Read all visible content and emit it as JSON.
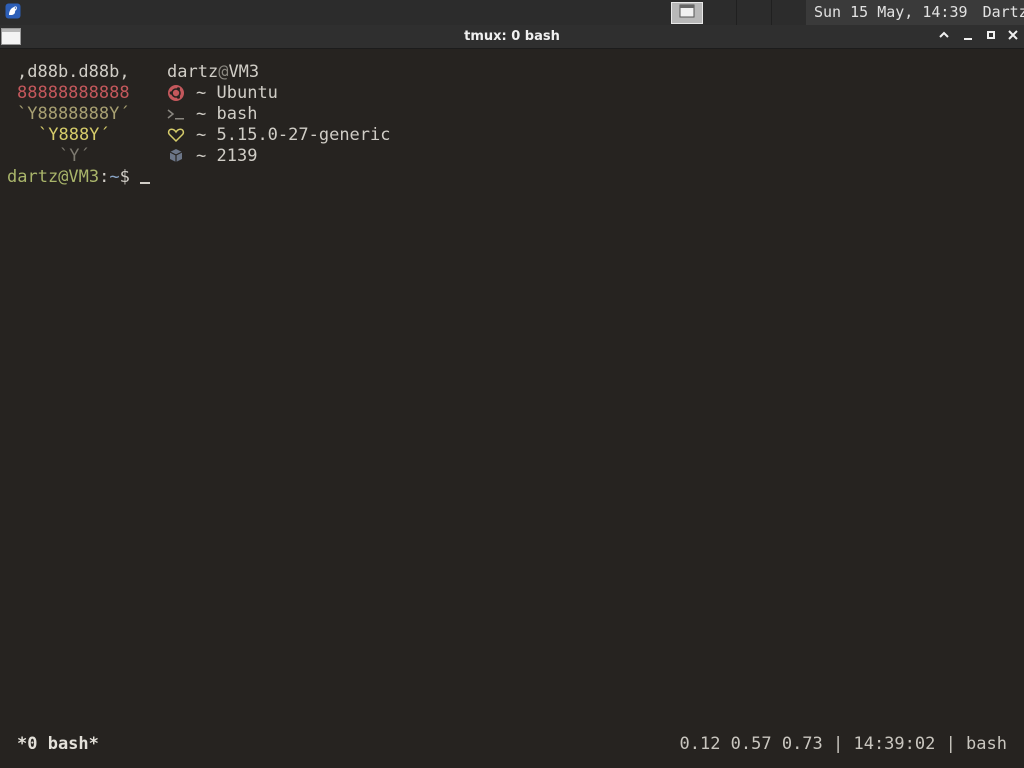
{
  "panel": {
    "clock": "Sun 15 May, 14:39",
    "user": "Dartz"
  },
  "window": {
    "title": "tmux: 0 bash"
  },
  "terminal": {
    "art": [
      ",d88b.d88b,",
      "88888888888",
      "`Y8888888Y´",
      "`Y888Y´",
      "`Y´"
    ],
    "fetch": {
      "user": "dartz",
      "at": "@",
      "host": "VM3",
      "rows": [
        {
          "icon": "ubuntu-icon",
          "sep": "~",
          "value": "Ubuntu",
          "color": "#c4585c"
        },
        {
          "icon": "shell-icon",
          "sep": "~",
          "value": "bash",
          "color": "#8a8780"
        },
        {
          "icon": "heart-icon",
          "sep": "~",
          "value": "5.15.0-27-generic",
          "color": "#d6cc6a"
        },
        {
          "icon": "package-icon",
          "sep": "~",
          "value": "2139",
          "color": "#8c96a8"
        }
      ]
    },
    "prompt": {
      "user_host": "dartz@VM3",
      "colon": ":",
      "path": "~",
      "symbol": "$"
    }
  },
  "tmux": {
    "window_label": "*0 bash*",
    "status_right": "0.12 0.57 0.73 | 14:39:02 | bash"
  }
}
